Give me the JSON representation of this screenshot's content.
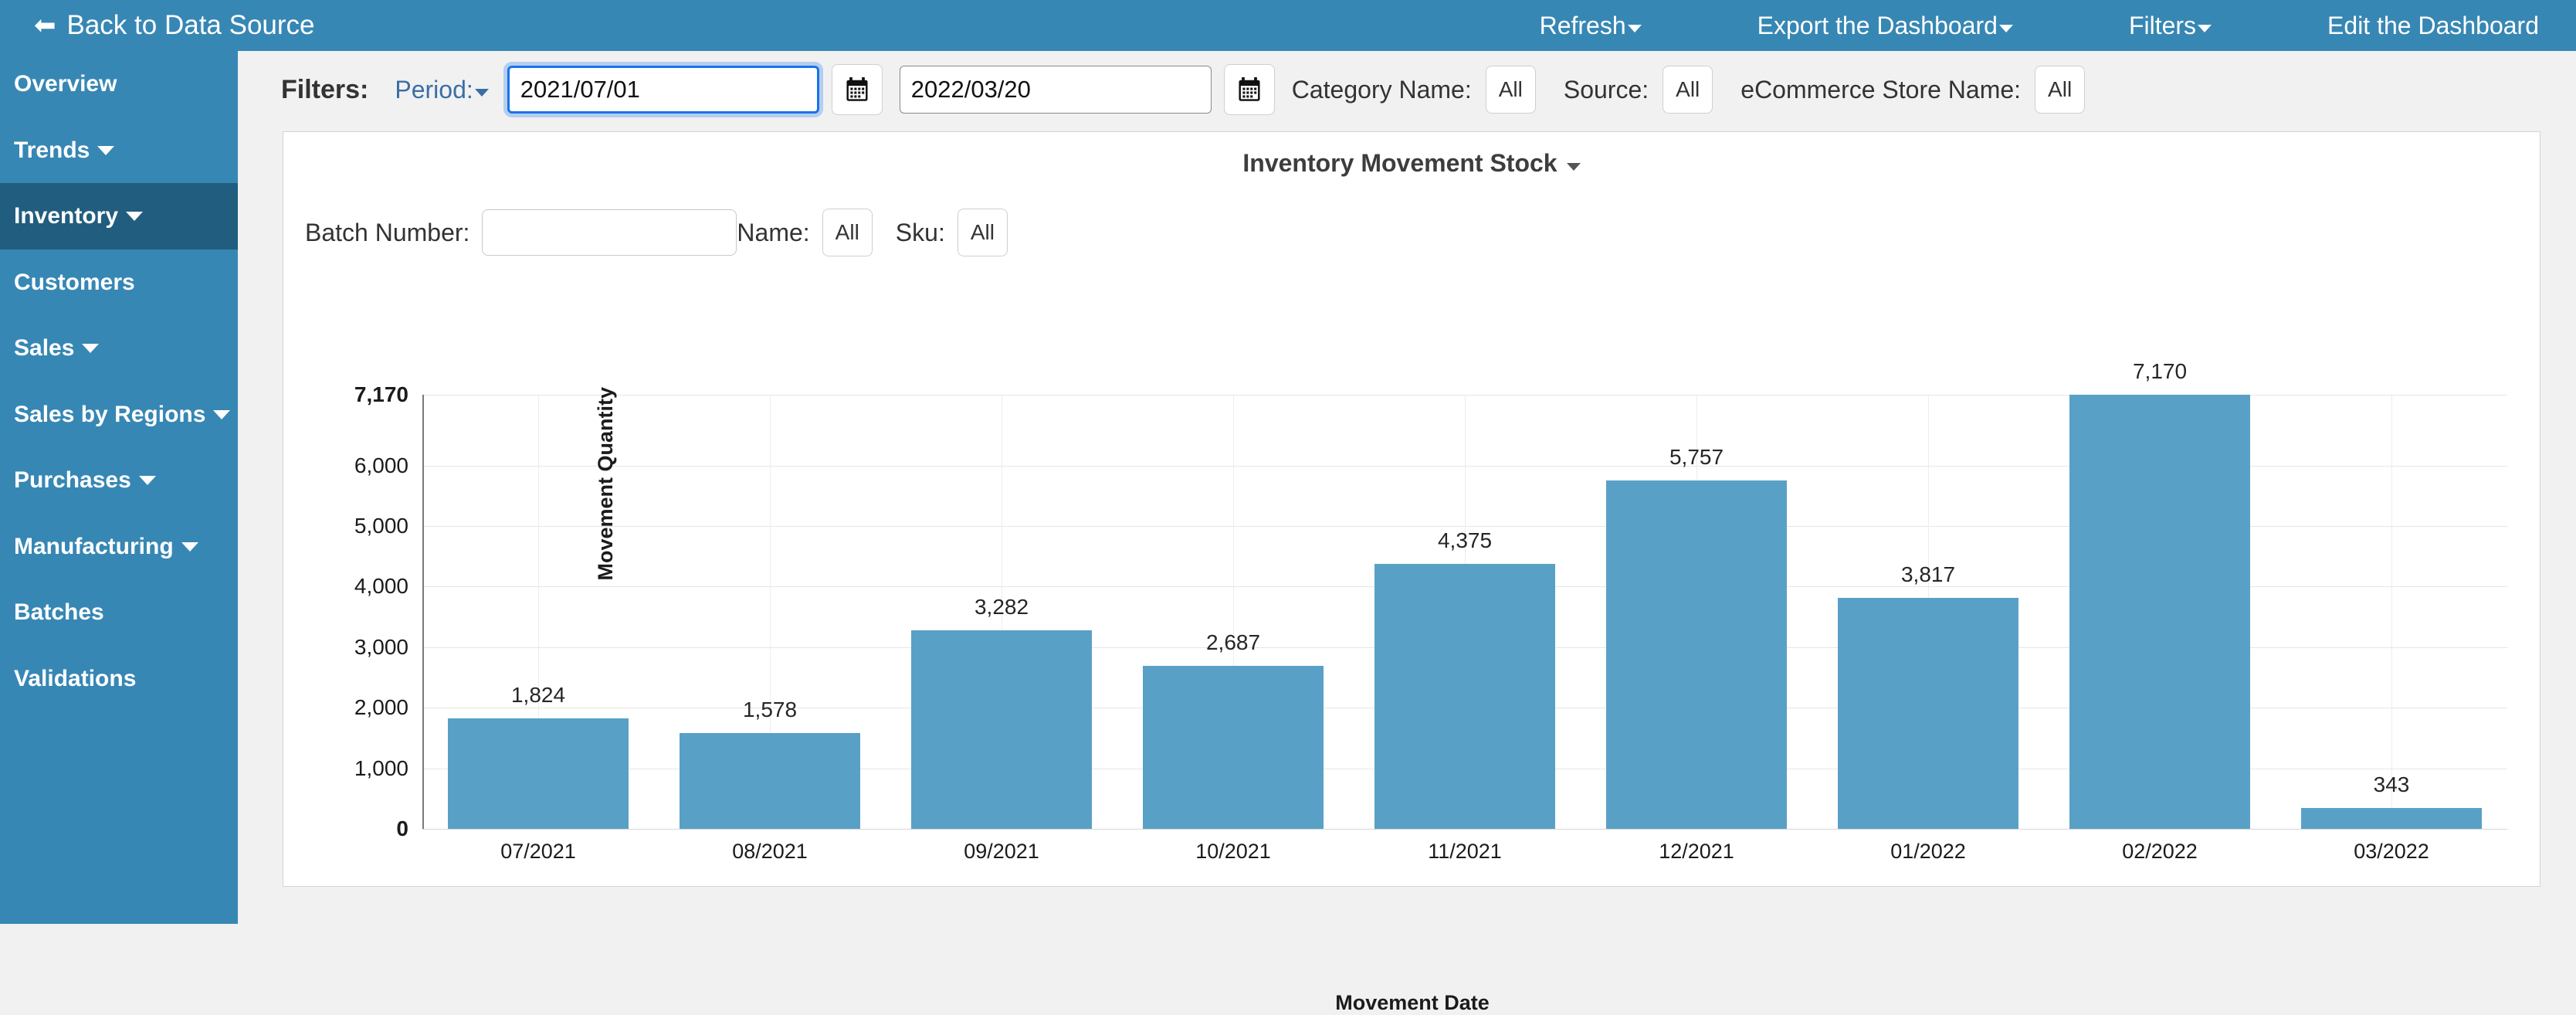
{
  "topbar": {
    "back_label": "Back to Data Source",
    "back_icon": "arrow-left-icon",
    "nav": [
      {
        "label": "Refresh",
        "caret": true
      },
      {
        "label": "Export the Dashboard",
        "caret": true
      },
      {
        "label": "Filters",
        "caret": true
      },
      {
        "label": "Edit the Dashboard",
        "caret": false
      }
    ]
  },
  "sidebar": {
    "background": "#3787b4",
    "active_background": "#215d7e",
    "items": [
      {
        "label": "Overview",
        "caret": false,
        "active": false
      },
      {
        "label": "Trends",
        "caret": true,
        "active": false
      },
      {
        "label": "Inventory",
        "caret": true,
        "active": true
      },
      {
        "label": "Customers",
        "caret": false,
        "active": false
      },
      {
        "label": "Sales",
        "caret": true,
        "active": false
      },
      {
        "label": "Sales by Regions",
        "caret": true,
        "active": false
      },
      {
        "label": "Purchases",
        "caret": true,
        "active": false
      },
      {
        "label": "Manufacturing",
        "caret": true,
        "active": false
      },
      {
        "label": "Batches",
        "caret": false,
        "active": false
      },
      {
        "label": "Validations",
        "caret": false,
        "active": false
      }
    ]
  },
  "filters": {
    "title": "Filters:",
    "period_label": "Period:",
    "date_from": "2021/07/01",
    "date_to": "2022/03/20",
    "calendar_icon": "calendar-icon",
    "category_name_label": "Category Name:",
    "category_name_value": "All",
    "source_label": "Source:",
    "source_value": "All",
    "store_label": "eCommerce Store Name:",
    "store_value": "All"
  },
  "card": {
    "title": "Inventory Movement Stock",
    "subfilters": {
      "batch_label": "Batch Number:",
      "batch_value": "",
      "batch_placeholder": "",
      "name_label": "Name:",
      "name_value": "All",
      "sku_label": "Sku:",
      "sku_value": "All"
    }
  },
  "chart_data": {
    "type": "bar",
    "title": "Inventory Movement Stock",
    "xlabel": "Movement Date",
    "ylabel": "Movement Quantity",
    "categories": [
      "07/2021",
      "08/2021",
      "09/2021",
      "10/2021",
      "11/2021",
      "12/2021",
      "01/2022",
      "02/2022",
      "03/2022"
    ],
    "values": [
      1824,
      1578,
      3282,
      2687,
      4375,
      5757,
      3817,
      7170,
      343
    ],
    "value_labels": [
      "1,824",
      "1,578",
      "3,282",
      "2,687",
      "4,375",
      "5,757",
      "3,817",
      "7,170",
      "343"
    ],
    "yticks": [
      0,
      1000,
      2000,
      3000,
      4000,
      5000,
      6000,
      7170
    ],
    "ytick_labels": [
      "0",
      "1,000",
      "2,000",
      "3,000",
      "4,000",
      "5,000",
      "6,000",
      "7,170"
    ],
    "ylim": [
      0,
      7170
    ],
    "grid": true,
    "legend": false,
    "bar_color": "#59a0c6"
  }
}
